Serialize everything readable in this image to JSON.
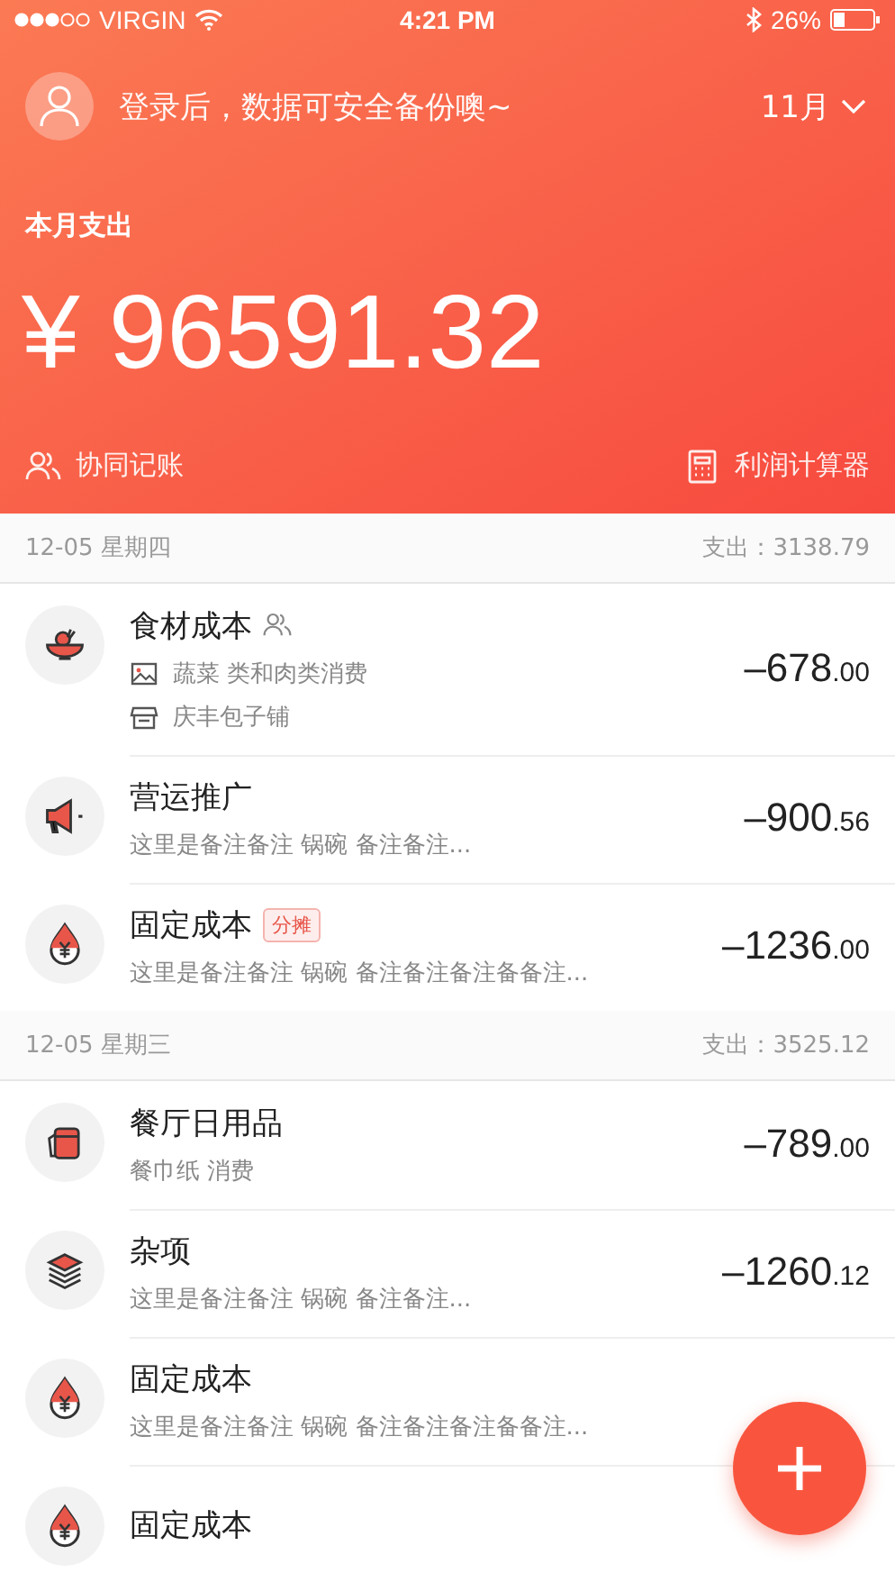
{
  "status_bar": {
    "carrier": "VIRGIN",
    "time": "4:21 PM",
    "battery": "26%"
  },
  "header": {
    "login_prompt": "登录后，数据可安全备份噢~",
    "month": "11月",
    "label": "本月支出",
    "total": "¥ 96591.32",
    "actions": [
      {
        "kind": "people",
        "label": "协同记账"
      },
      {
        "kind": "calculator",
        "label": "利润计算器"
      }
    ]
  },
  "groups": [
    {
      "date": "12-05 星期四",
      "total": "支出：3138.79",
      "entries": [
        {
          "kind": "bowl",
          "title": "食材成本",
          "shared": true,
          "details": [
            {
              "kind": "image",
              "text": "蔬菜 类和肉类消费"
            },
            {
              "kind": "shop",
              "text": "庆丰包子铺"
            }
          ],
          "amount": "–678",
          "cents": ".00"
        },
        {
          "kind": "megaphone",
          "title": "营运推广",
          "note": "这里是备注备注 锅碗 备注备注...",
          "amount": "–900",
          "cents": ".56"
        },
        {
          "kind": "drop",
          "title": "固定成本",
          "tag": "分摊",
          "note": "这里是备注备注 锅碗 备注备注备注备备注...",
          "amount": "–1236",
          "cents": ".00"
        }
      ]
    },
    {
      "date": "12-05 星期三",
      "total": "支出：3525.12",
      "entries": [
        {
          "kind": "roll",
          "title": "餐厅日用品",
          "note": "餐巾纸 消费",
          "amount": "–789",
          "cents": ".00"
        },
        {
          "kind": "layers",
          "title": "杂项",
          "note": "这里是备注备注 锅碗 备注备注...",
          "amount": "–1260",
          "cents": ".12"
        },
        {
          "kind": "drop",
          "title": "固定成本",
          "note": "这里是备注备注 锅碗 备注备注备注备备注..."
        },
        {
          "kind": "drop",
          "title": "固定成本"
        }
      ]
    }
  ]
}
